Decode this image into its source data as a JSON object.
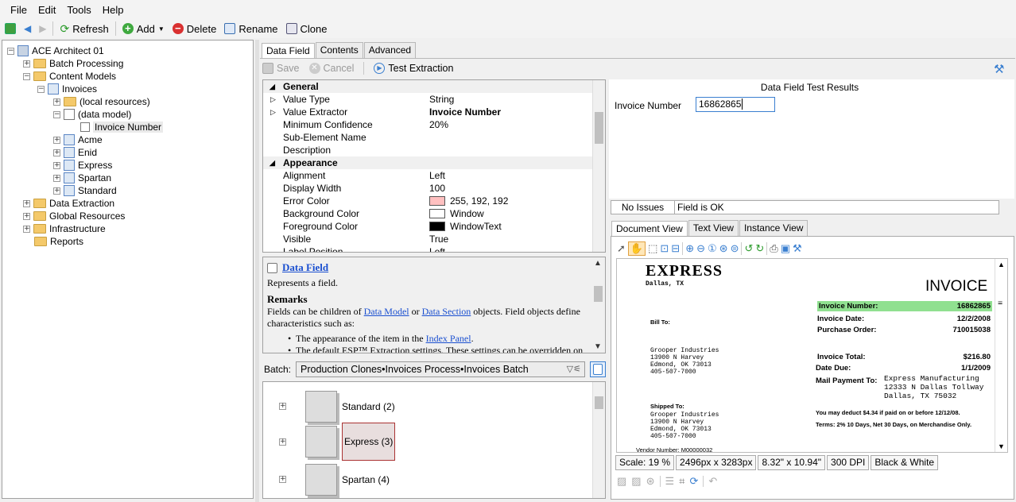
{
  "menu": {
    "file": "File",
    "edit": "Edit",
    "tools": "Tools",
    "help": "Help"
  },
  "toolbar": {
    "refresh": "Refresh",
    "add": "Add",
    "delete": "Delete",
    "rename": "Rename",
    "clone": "Clone"
  },
  "tree": {
    "root": "ACE Architect 01",
    "batch_processing": "Batch Processing",
    "content_models": "Content Models",
    "invoices": "Invoices",
    "local_resources": "(local resources)",
    "data_model": "(data model)",
    "invoice_number": "Invoice Number",
    "acme": "Acme",
    "enid": "Enid",
    "express": "Express",
    "spartan": "Spartan",
    "standard": "Standard",
    "data_extraction": "Data Extraction",
    "global_resources": "Global Resources",
    "infrastructure": "Infrastructure",
    "reports": "Reports"
  },
  "tabs": {
    "data_field": "Data Field",
    "contents": "Contents",
    "advanced": "Advanced"
  },
  "actions": {
    "save": "Save",
    "cancel": "Cancel",
    "test": "Test Extraction"
  },
  "props": {
    "general": "General",
    "value_type": "Value Type",
    "value_type_v": "String",
    "value_extractor": "Value Extractor",
    "value_extractor_v": "Invoice Number",
    "min_conf": "Minimum Confidence",
    "min_conf_v": "20%",
    "sub_element": "Sub-Element Name",
    "description": "Description",
    "appearance": "Appearance",
    "alignment": "Alignment",
    "alignment_v": "Left",
    "display_width": "Display Width",
    "display_width_v": "100",
    "error_color": "Error Color",
    "error_color_v": "255, 192, 192",
    "bg_color": "Background Color",
    "bg_color_v": "Window",
    "fg_color": "Foreground Color",
    "fg_color_v": "WindowText",
    "visible": "Visible",
    "visible_v": "True",
    "label_pos": "Label Position",
    "label_pos_v": "Left"
  },
  "colors": {
    "error": "#ffc0c0",
    "window": "#ffffff",
    "windowtext": "#000000",
    "highlight": "#90e090"
  },
  "help": {
    "title": "Data Field",
    "line1": "Represents a field.",
    "remarks": "Remarks",
    "p1a": "Fields can be children of ",
    "link1": "Data Model",
    "p1b": " or ",
    "link2": "Data Section",
    "p1c": " objects. Field objects define characteristics such as:",
    "b1a": "The appearance of the item in the ",
    "b1link": "Index Panel",
    "b1b": ".",
    "b2": "The default ESP™ Extraction settings. These settings can be overridden on"
  },
  "batch": {
    "label": "Batch:",
    "value": "Production Clones•Invoices Process•Invoices Batch"
  },
  "thumbs": [
    "Standard (2)",
    "Express (3)",
    "Spartan (4)"
  ],
  "results": {
    "title": "Data Field Test Results",
    "field_label": "Invoice Number",
    "field_value": "16862865",
    "issues": "No Issues",
    "ok": "Field is OK"
  },
  "doc_tabs": {
    "document": "Document View",
    "text": "Text View",
    "instance": "Instance View"
  },
  "invoice": {
    "company": "EXPRESS",
    "city": "Dallas, TX",
    "title": "INVOICE",
    "num_label": "Invoice Number:",
    "num": "16862865",
    "date_label": "Invoice Date:",
    "date": "12/2/2008",
    "po_label": "Purchase Order:",
    "po": "710015038",
    "bill_to": "Bill To:",
    "bill_lines": [
      "Grooper Industries",
      "13900 N Harvey",
      "Edmond, OK 73013",
      "405-507-7000"
    ],
    "total_label": "Invoice Total:",
    "total": "$216.80",
    "due_label": "Date Due:",
    "due": "1/1/2009",
    "mail_label": "Mail Payment To:",
    "mail_lines": [
      "Express Manufacturing",
      "12333 N Dallas Tollway",
      "Dallas, TX 75032"
    ],
    "ship_to": "Shipped To:",
    "ship_lines": [
      "Grooper Industries",
      "13900 N Harvey",
      "Edmond, OK 73013",
      "405-507-7000"
    ],
    "deduct": "You may deduct $4.34 if paid on or before 12/12/08.",
    "terms": "Terms: 2% 10 Days, Net 30 Days, on Merchandise Only.",
    "vendor": "Vendor Number:  M00000032"
  },
  "status": {
    "scale": "Scale: 19 %",
    "px": "2496px x 3283px",
    "inches": "8.32\" x 10.94\"",
    "dpi": "300 DPI",
    "mode": "Black & White"
  }
}
